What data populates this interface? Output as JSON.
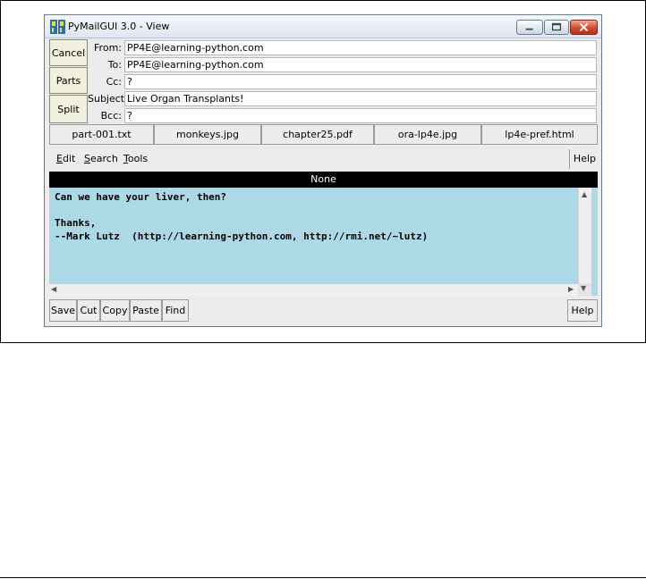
{
  "window": {
    "title": "PyMailGUI 3.0 - View"
  },
  "header_buttons": {
    "cancel": "Cancel",
    "parts": "Parts",
    "split": "Split"
  },
  "headers": [
    {
      "label": "From:",
      "value": "PP4E@learning-python.com"
    },
    {
      "label": "To:",
      "value": "PP4E@learning-python.com"
    },
    {
      "label": "Cc:",
      "value": "?"
    },
    {
      "label": "Subject:",
      "value": "Live Organ Transplants!"
    },
    {
      "label": "Bcc:",
      "value": "?"
    }
  ],
  "parts": [
    "part-001.txt",
    "monkeys.jpg",
    "chapter25.pdf",
    "ora-lp4e.jpg",
    "lp4e-pref.html"
  ],
  "menu": {
    "edit": {
      "u": "E",
      "rest": "dit"
    },
    "search": {
      "u": "S",
      "rest": "earch"
    },
    "tools": {
      "u": "T",
      "rest": "ools"
    },
    "help": "Help"
  },
  "status": "None",
  "body": "Can we have your liver, then?\n\nThanks,\n--Mark Lutz  (http://learning-python.com, http://rmi.net/~lutz)",
  "toolbar": {
    "save": "Save",
    "cut": "Cut",
    "copy": "Copy",
    "paste": "Paste",
    "find": "Find",
    "help": "Help"
  },
  "colors": {
    "body_bg": "#add8e6",
    "header_button_bg": "#f1f0dc",
    "status_bg": "#000000"
  }
}
